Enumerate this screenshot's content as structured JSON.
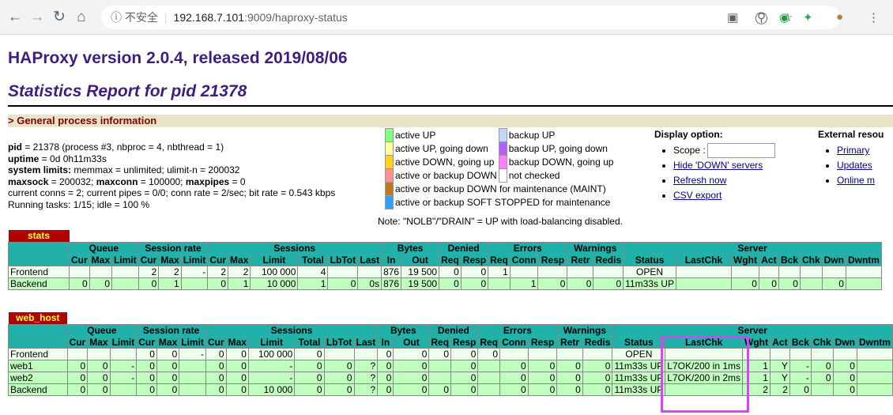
{
  "browser": {
    "security": "不安全",
    "host": "192.168.7.101",
    "path": ":9009/haproxy-status"
  },
  "title": "HAProxy version 2.0.4, released 2019/08/06",
  "subtitle": "Statistics Report for pid 21378",
  "section": "> General process information",
  "pinfo": [
    {
      "k": "pid",
      "v": " = 21378 (process #3, nbproc = 4, nbthread = 1)"
    },
    {
      "k": "uptime",
      "v": " = 0d 0h11m33s"
    },
    {
      "k": "system limits:",
      "v": " memmax = unlimited; ulimit-n = 200032"
    },
    {
      "k": "maxsock",
      "v": " = 200032; "
    },
    {
      "k": "",
      "v": "current conns = 2; current pipes = 0/0; conn rate = 2/sec; bit rate = 0.543 kbps"
    },
    {
      "k": "",
      "v": "Running tasks: 1/15; idle = 100 %"
    }
  ],
  "pinfo_extra": {
    "maxconn_k": "maxconn",
    "maxconn_v": " = 100000; ",
    "maxpipes_k": "maxpipes",
    "maxpipes_v": " = 0"
  },
  "legend": {
    "rows": [
      {
        "c1": "#80ff80",
        "l1": "active UP",
        "c2": "#c0d8ff",
        "l2": "backup UP"
      },
      {
        "c1": "#ffffa0",
        "l1": "active UP, going down",
        "c2": "#b060ff",
        "l2": "backup UP, going down"
      },
      {
        "c1": "#ffd020",
        "l1": "active DOWN, going up",
        "c2": "#ff80ff",
        "l2": "backup DOWN, going up"
      },
      {
        "c1": "#ff9090",
        "l1": "active or backup DOWN",
        "c2": "#ffffff",
        "l2": "not checked"
      }
    ],
    "maint_color": "#c07820",
    "maint": "active or backup DOWN for maintenance (MAINT)",
    "soft_color": "#30a0ff",
    "soft": "active or backup SOFT STOPPED for maintenance",
    "note": "Note: \"NOLB\"/\"DRAIN\" = UP with load-balancing disabled."
  },
  "display": {
    "title": "Display option:",
    "scope": "Scope :",
    "hide": "Hide 'DOWN' servers",
    "refresh": "Refresh now",
    "csv": "CSV export"
  },
  "external": {
    "title": "External resou",
    "links": [
      "Primary",
      "Updates",
      "Online m"
    ]
  },
  "groups": [
    "Queue",
    "Session rate",
    "Sessions",
    "Bytes",
    "Denied",
    "Errors",
    "Warnings",
    "Server"
  ],
  "subs1": [
    "Cur",
    "Max",
    "Limit",
    "Cur",
    "Max",
    "Limit",
    "Cur",
    "Max",
    "Limit",
    "Total",
    "LbTot",
    "Last",
    "In",
    "Out",
    "Req",
    "Resp",
    "Req",
    "Conn",
    "Resp",
    "Retr",
    "Redis",
    "Status",
    "LastChk",
    "Wght",
    "Act",
    "Bck",
    "Chk",
    "Dwn",
    "Dwntm"
  ],
  "stats": {
    "name": "stats",
    "rows": [
      [
        "Frontend",
        "",
        "",
        "",
        "2",
        "2",
        "-",
        "2",
        "2",
        "100 000",
        "4",
        "",
        "",
        "876",
        "19 500",
        "0",
        "0",
        "1",
        "",
        "",
        "",
        "",
        "OPEN",
        "",
        "",
        "",
        "",
        "",
        "",
        ""
      ],
      [
        "Backend",
        "0",
        "0",
        "",
        "0",
        "1",
        "",
        "0",
        "1",
        "10 000",
        "1",
        "0",
        "0s",
        "876",
        "19 500",
        "0",
        "0",
        "",
        "1",
        "0",
        "0",
        "0",
        "11m33s UP",
        "",
        "0",
        "0",
        "0",
        "",
        "0",
        ""
      ]
    ]
  },
  "web": {
    "name": "web_host",
    "rows": [
      [
        "Frontend",
        "",
        "",
        "",
        "0",
        "0",
        "-",
        "0",
        "0",
        "100 000",
        "0",
        "",
        "",
        "0",
        "0",
        "0",
        "0",
        "0",
        "",
        "",
        "",
        "",
        "OPEN",
        "",
        "",
        "",
        "",
        "",
        "",
        ""
      ],
      [
        "web1",
        "0",
        "0",
        "-",
        "0",
        "0",
        "",
        "0",
        "0",
        "-",
        "0",
        "0",
        "?",
        "0",
        "0",
        "",
        "0",
        "",
        "0",
        "0",
        "0",
        "0",
        "11m33s UP",
        "L7OK/200 in 1ms",
        "1",
        "Y",
        "-",
        "0",
        "0",
        ""
      ],
      [
        "web2",
        "0",
        "0",
        "-",
        "0",
        "0",
        "",
        "0",
        "0",
        "-",
        "0",
        "0",
        "?",
        "0",
        "0",
        "",
        "0",
        "",
        "0",
        "0",
        "0",
        "0",
        "11m33s UP",
        "L7OK/200 in 2ms",
        "1",
        "Y",
        "-",
        "0",
        "0",
        ""
      ],
      [
        "Backend",
        "0",
        "0",
        "",
        "0",
        "0",
        "",
        "0",
        "0",
        "10 000",
        "0",
        "0",
        "?",
        "0",
        "0",
        "0",
        "0",
        "",
        "0",
        "0",
        "0",
        "0",
        "11m33s UP",
        "",
        "2",
        "2",
        "0",
        "",
        "0",
        ""
      ]
    ]
  }
}
